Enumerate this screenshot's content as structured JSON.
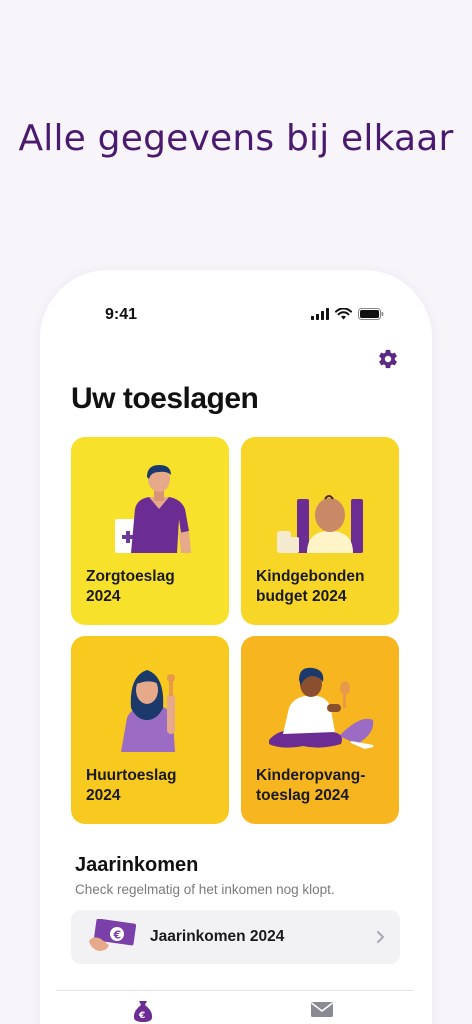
{
  "headline": "Alle gegevens bij elkaar",
  "status": {
    "time": "9:41"
  },
  "page_title": "Uw toeslagen",
  "tiles": [
    {
      "label_line1": "Zorgtoeslag",
      "label_line2": "2024"
    },
    {
      "label_line1": "Kindgebonden",
      "label_line2": "budget 2024"
    },
    {
      "label_line1": "Huurtoeslag",
      "label_line2": "2024"
    },
    {
      "label_line1": "Kinderopvang-",
      "label_line2": "toeslag 2024"
    }
  ],
  "income": {
    "title": "Jaarinkomen",
    "subtitle": "Check regelmatig of het inkomen nog klopt.",
    "row_label": "Jaarinkomen 2024"
  },
  "icons": {
    "settings": "gear-icon",
    "tab_home": "money-bag-icon",
    "tab_mail": "mail-icon"
  },
  "colors": {
    "accent": "#5b2a86",
    "headline": "#4a1a6e",
    "tile1": "#f7e12a",
    "tile2": "#f8d627",
    "tile3": "#f8c91f",
    "tile4": "#f7b520"
  }
}
